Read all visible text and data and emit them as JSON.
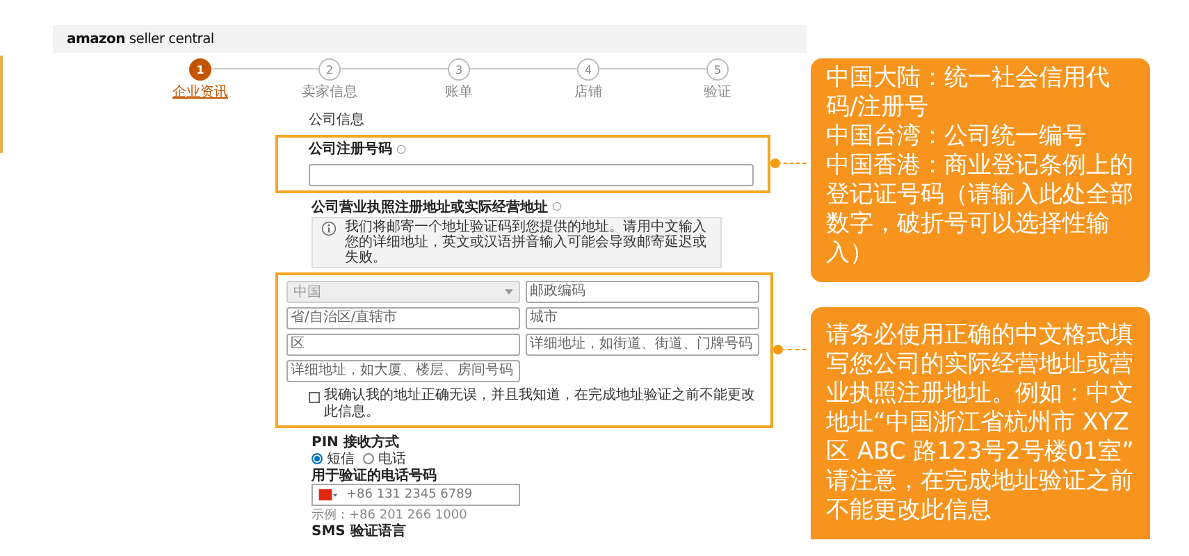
{
  "header": {
    "logo": "amazon",
    "product": "seller central"
  },
  "steps": [
    {
      "number": "1",
      "label": "企业资讯",
      "selected": true
    },
    {
      "number": "2",
      "label": "卖家信息",
      "selected": false
    },
    {
      "number": "3",
      "label": "账单",
      "selected": false
    },
    {
      "number": "4",
      "label": "店铺",
      "selected": false
    },
    {
      "number": "5",
      "label": "验证",
      "selected": false
    }
  ],
  "form": {
    "section_title": "公司信息",
    "registration": {
      "label": "公司注册号码"
    },
    "address": {
      "label": "公司营业执照注册地址或实际经营地址",
      "notice": "我们将邮寄一个地址验证码到您提供的地址。请用中文输入您的详细地址，英文或汉语拼音输入可能会导致邮寄延迟或失败。",
      "fields": [
        {
          "kind": "select",
          "value": "中国",
          "disabled": true
        },
        {
          "kind": "input",
          "placeholder": "邮政编码"
        },
        {
          "kind": "input",
          "placeholder": "省/自治区/直辖市"
        },
        {
          "kind": "input",
          "placeholder": "城市"
        },
        {
          "kind": "input",
          "placeholder": "区"
        },
        {
          "kind": "input",
          "placeholder": "详细地址，如街道、街道、门牌号码"
        },
        {
          "kind": "input",
          "placeholder": "详细地址，如大厦、楼层、房间号码"
        }
      ],
      "confirm": {
        "label": "我确认我的地址正确无误，并且我知道，在完成地址验证之前不能更改此信息。",
        "checked": false
      }
    },
    "pin": {
      "label": "PIN 接收方式",
      "options": [
        {
          "label": "短信",
          "selected": true
        },
        {
          "label": "电话",
          "selected": false
        }
      ]
    },
    "phone": {
      "label": "用于验证的电话号码",
      "value": "+86 131 2345 6789",
      "example": "示例：+86 201 266 1000"
    },
    "sms_language": {
      "label": "SMS 验证语言"
    }
  },
  "callouts": [
    {
      "paragraphs": [
        "中国大陆：统一社会信用代码/注册号",
        "中国台湾：公司统一编号",
        "中国香港：商业登记条例上的登记证号码（请输入此处全部数字，破折号可以选择性输入）"
      ]
    },
    {
      "paragraphs": [
        "请务必使用正确的中文格式填写您公司的实际经营地址或营业执照注册地址。例如：中文地址“中国浙江省杭州市 XYZ 区 ABC 路123号2号楼01室”",
        "请注意，在完成地址验证之前不能更改此信息"
      ]
    }
  ]
}
